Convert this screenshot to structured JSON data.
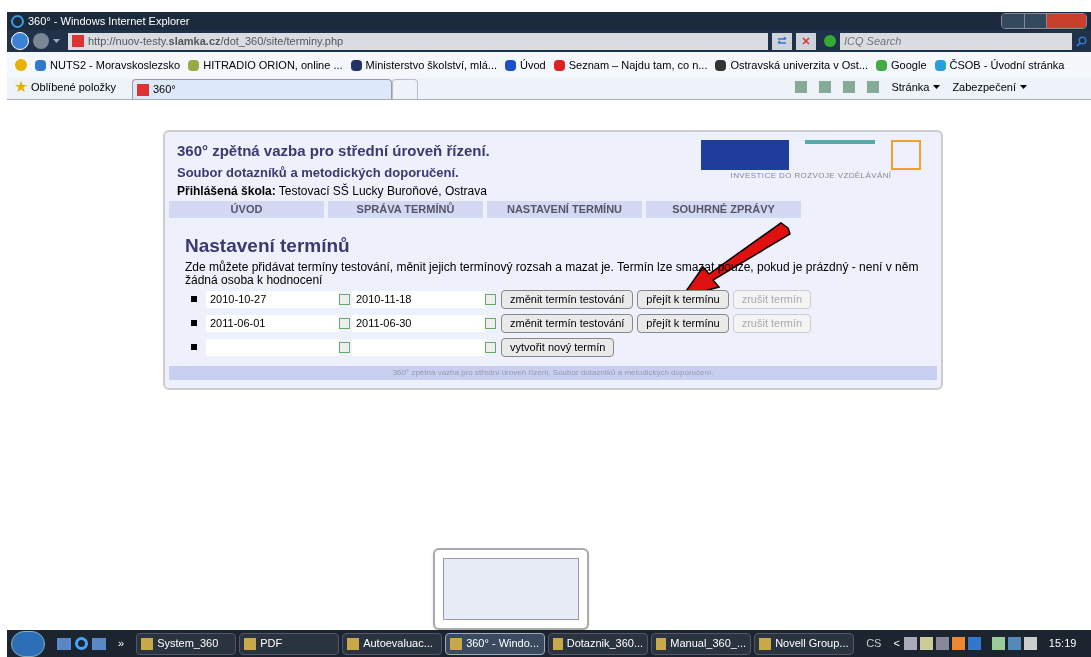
{
  "window": {
    "title": "360° - Windows Internet Explorer"
  },
  "address": {
    "url": "http://nuov-testy.**slamka.cz**/dot_360/site/terminy.php"
  },
  "search": {
    "placeholder": "ICQ Search"
  },
  "favorites": [
    "NUTS2 - Moravskoslezsko",
    "HITRADIO ORION, online ...",
    "Ministerstvo školství, mlá...",
    "Úvod",
    "Seznam – Najdu tam, co n...",
    "Ostravská univerzita v Ost...",
    "Google",
    "ČSOB - Úvodní stránka"
  ],
  "favorites_button": "Oblíbené položky",
  "tabs": [
    {
      "label": "360°",
      "selected": true
    }
  ],
  "command_bar": [
    "Stránka",
    "Zabezpečení"
  ],
  "page": {
    "title": "360° zpětná vazba pro střední úroveň řízení.",
    "subtitle": "Soubor dotazníků a metodických doporučení.",
    "school_label": "Přihlášená škola:",
    "school": "Testovací SŠ Lucky Buroňové, Ostrava",
    "logo_caption": "INVESTICE DO ROZVOJE VZDĚLÁVÁNÍ",
    "nav": [
      "ÚVOD",
      "SPRÁVA TERMÍNŮ",
      "NASTAVENÍ TERMÍNU",
      "SOUHRNÉ ZPRÁVY"
    ],
    "heading": "Nastavení termínů",
    "description": "Zde můžete přidávat termíny testování, měnit jejich termínový rozsah a mazat je. Termín lze smazat pouze, pokud je prázdný - není v něm žádná osoba k hodnocení",
    "rows": [
      {
        "from": "2010-10-27",
        "to": "2010-11-18",
        "buttons": [
          {
            "label": "změnit termín testování",
            "disabled": false
          },
          {
            "label": "přejít k termínu",
            "disabled": false
          },
          {
            "label": "zrušit termín",
            "disabled": true
          }
        ]
      },
      {
        "from": "2011-06-01",
        "to": "2011-06-30",
        "buttons": [
          {
            "label": "změnit termín testování",
            "disabled": false
          },
          {
            "label": "přejít k termínu",
            "disabled": false
          },
          {
            "label": "zrušit termín",
            "disabled": true
          }
        ]
      },
      {
        "from": "",
        "to": "",
        "buttons": [
          {
            "label": "vytvořit nový termín",
            "disabled": false
          }
        ]
      }
    ],
    "footer": "360° zpětná vazba pro střední úroveň řízení. Soubor dotazníků a metodických doporučení."
  },
  "taskbar": {
    "more": "»",
    "items": [
      {
        "label": "System_360",
        "selected": false
      },
      {
        "label": "PDF",
        "selected": false
      },
      {
        "label": "Autoevaluac...",
        "selected": false
      },
      {
        "label": "360° - Windo...",
        "selected": true
      },
      {
        "label": "Dotaznik_360...",
        "selected": false
      },
      {
        "label": "Manual_360_...",
        "selected": false
      },
      {
        "label": "Novell Group...",
        "selected": false
      }
    ],
    "language": "CS",
    "tray_arrow": "<",
    "clock": "15:19"
  }
}
